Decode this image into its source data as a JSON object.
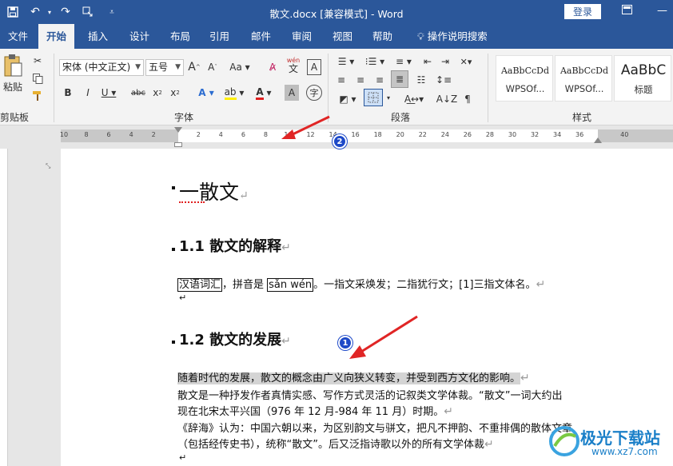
{
  "titlebar": {
    "title": "散文.docx [兼容模式]  -  Word",
    "login": "登录"
  },
  "tabs": [
    "文件",
    "开始",
    "插入",
    "设计",
    "布局",
    "引用",
    "邮件",
    "审阅",
    "视图",
    "帮助"
  ],
  "tell_me": "操作说明搜索",
  "ribbon": {
    "paste": "粘贴",
    "clipboard": "剪贴板",
    "font_name": "宋体 (中文正文)",
    "font_size": "五号",
    "font_group": "字体",
    "paragraph_group": "段落",
    "styles_group": "样式",
    "wen_ruby": "wén",
    "wen_char": "文",
    "styles": [
      {
        "sample": "AaBbCcDd",
        "name": "WPSOf..."
      },
      {
        "sample": "AaBbCcDd",
        "name": "WPSOf..."
      },
      {
        "sample": "AaBbC",
        "name": "标题"
      }
    ]
  },
  "ruler": {
    "numbers": [
      "10",
      "8",
      "6",
      "4",
      "2",
      "",
      "2",
      "4",
      "6",
      "8",
      "10",
      "12",
      "14",
      "16",
      "18",
      "20",
      "22",
      "24",
      "26",
      "28",
      "30",
      "32",
      "34",
      "36",
      "",
      "40"
    ]
  },
  "document": {
    "h1": "一散文",
    "h2a": "1.1 散文的解释",
    "line1_boxed1": "汉语词汇",
    "line1_mid": "，拼音是 ",
    "line1_boxed2": "sǎn wén",
    "line1_rest": "。一指文采焕发；二指犹行文；[1]三指文体名。",
    "h2b": "1.2 散文的发展",
    "p1": "随着时代的发展，散文的概念由广义向狭义转变，并受到西方文化的影响。",
    "p2a": "散文是一种抒发作者真情实感、写作方式灵活的记叙类文学体裁。“散文”一词大约出",
    "p2b": "现在北宋太平兴国（976 年 12 月-984 年 11 月）时期。",
    "p3a": "《辞海》认为：中国六朝以来，为区别韵文与骈文，把凡不押韵、不重排偶的散体文章",
    "p3b": "（包括经传史书），统称“散文”。后又泛指诗歌以外的所有文学体裁",
    "para_mark": "↵"
  },
  "annotations": {
    "badge1": "1",
    "badge2": "2"
  },
  "watermark": {
    "text": "极光下载站",
    "url": "www.xz7.com"
  },
  "colors": {
    "accent": "#2b579a",
    "arrow": "#e02525",
    "badge": "#1d49c8"
  }
}
